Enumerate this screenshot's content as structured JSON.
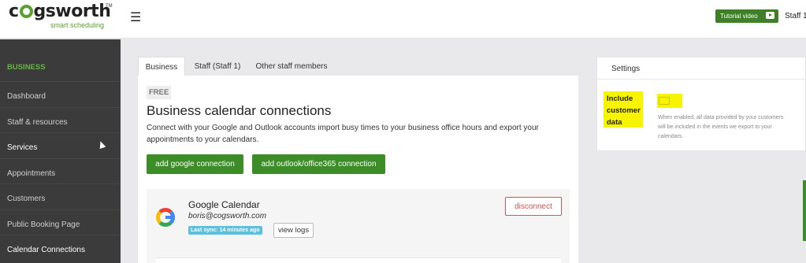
{
  "brand": {
    "name_prefix": "c",
    "name_suffix": "gsworth",
    "tagline": "smart scheduling",
    "tm": "TM"
  },
  "topbar": {
    "menu_glyph": "☰",
    "tutorial_label": "Tutorial video",
    "staff_label": "Staff 1"
  },
  "sidebar": {
    "section": "BUSINESS",
    "items": [
      "Dashboard",
      "Staff & resources",
      "Services",
      "Appointments",
      "Customers",
      "Public Booking Page",
      "Calendar Connections"
    ]
  },
  "tabs": [
    "Business",
    "Staff (Staff 1)",
    "Other staff members"
  ],
  "main": {
    "badge": "FREE",
    "title": "Business calendar connections",
    "description": "Connect with your Google and Outlook accounts import busy times to your business office hours and export your appointments to your calendars.",
    "add_google": "add google connection",
    "add_outlook": "add outlook/office365 connection"
  },
  "calendar": {
    "name": "Google Calendar",
    "email": "boris@cogsworth.com",
    "last_sync": "Last sync: 14 minutes ago",
    "view_logs": "view logs",
    "disconnect": "disconnect"
  },
  "settings": {
    "title": "Settings",
    "option_label": "Include customer data",
    "option_help": "When enabled, all data provided by your customers will be included in the events we export to your calendars."
  },
  "colors": {
    "accent": "#3c8c27",
    "sidebar_bg": "#3b3b3b",
    "highlight": "#f8f400",
    "danger": "#d9534f",
    "sync_badge": "#5bc0de"
  }
}
